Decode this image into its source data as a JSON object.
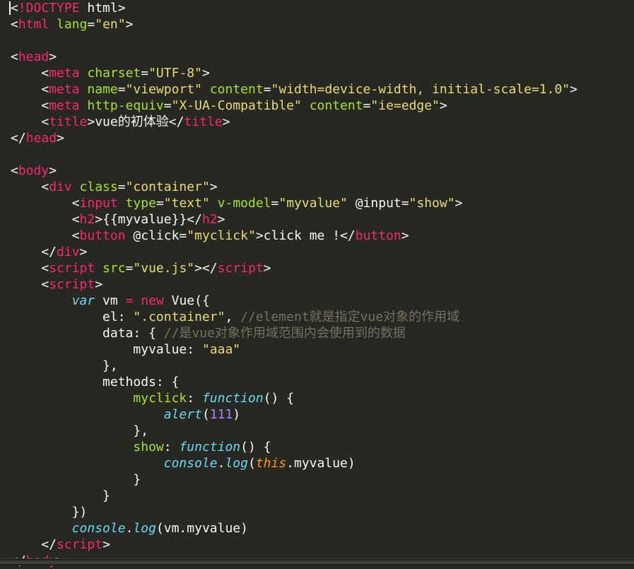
{
  "language": "html",
  "colors": {
    "background": "#272822",
    "tag": "#f92672",
    "attribute": "#a6e22e",
    "string": "#e6db74",
    "keyword": "#66d9ef",
    "comment": "#75715e",
    "number": "#ae81ff",
    "this": "#fd971f",
    "text": "#f8f8f2"
  },
  "lines": [
    [
      {
        "t": "<",
        "c": "pun"
      },
      {
        "t": "!DOCTYPE",
        "c": "dkw"
      },
      {
        "t": " html>",
        "c": "doct"
      }
    ],
    [
      {
        "t": "<",
        "c": "pun"
      },
      {
        "t": "html",
        "c": "tag"
      },
      {
        "t": " ",
        "c": "txt"
      },
      {
        "t": "lang",
        "c": "attr"
      },
      {
        "t": "=",
        "c": "pun"
      },
      {
        "t": "\"en\"",
        "c": "str"
      },
      {
        "t": ">",
        "c": "pun"
      }
    ],
    [],
    [
      {
        "t": "<",
        "c": "pun"
      },
      {
        "t": "head",
        "c": "tag"
      },
      {
        "t": ">",
        "c": "pun"
      }
    ],
    [
      {
        "t": "    <",
        "c": "pun"
      },
      {
        "t": "meta",
        "c": "tag"
      },
      {
        "t": " ",
        "c": "txt"
      },
      {
        "t": "charset",
        "c": "attr"
      },
      {
        "t": "=",
        "c": "pun"
      },
      {
        "t": "\"UTF-8\"",
        "c": "str"
      },
      {
        "t": ">",
        "c": "pun"
      }
    ],
    [
      {
        "t": "    <",
        "c": "pun"
      },
      {
        "t": "meta",
        "c": "tag"
      },
      {
        "t": " ",
        "c": "txt"
      },
      {
        "t": "name",
        "c": "attr"
      },
      {
        "t": "=",
        "c": "pun"
      },
      {
        "t": "\"viewport\"",
        "c": "str"
      },
      {
        "t": " ",
        "c": "txt"
      },
      {
        "t": "content",
        "c": "attr"
      },
      {
        "t": "=",
        "c": "pun"
      },
      {
        "t": "\"width=device-width, initial-scale=1.0\"",
        "c": "str"
      },
      {
        "t": ">",
        "c": "pun"
      }
    ],
    [
      {
        "t": "    <",
        "c": "pun"
      },
      {
        "t": "meta",
        "c": "tag"
      },
      {
        "t": " ",
        "c": "txt"
      },
      {
        "t": "http-equiv",
        "c": "attr"
      },
      {
        "t": "=",
        "c": "pun"
      },
      {
        "t": "\"X-UA-Compatible\"",
        "c": "str"
      },
      {
        "t": " ",
        "c": "txt"
      },
      {
        "t": "content",
        "c": "attr"
      },
      {
        "t": "=",
        "c": "pun"
      },
      {
        "t": "\"ie=edge\"",
        "c": "str"
      },
      {
        "t": ">",
        "c": "pun"
      }
    ],
    [
      {
        "t": "    <",
        "c": "pun"
      },
      {
        "t": "title",
        "c": "tag"
      },
      {
        "t": ">",
        "c": "pun"
      },
      {
        "t": "vue的初体验",
        "c": "txt"
      },
      {
        "t": "</",
        "c": "pun"
      },
      {
        "t": "title",
        "c": "tag"
      },
      {
        "t": ">",
        "c": "pun"
      }
    ],
    [
      {
        "t": "</",
        "c": "pun"
      },
      {
        "t": "head",
        "c": "tag"
      },
      {
        "t": ">",
        "c": "pun"
      }
    ],
    [],
    [
      {
        "t": "<",
        "c": "pun"
      },
      {
        "t": "body",
        "c": "tag"
      },
      {
        "t": ">",
        "c": "pun"
      }
    ],
    [
      {
        "t": "    <",
        "c": "pun"
      },
      {
        "t": "div",
        "c": "tag"
      },
      {
        "t": " ",
        "c": "txt"
      },
      {
        "t": "class",
        "c": "attr"
      },
      {
        "t": "=",
        "c": "pun"
      },
      {
        "t": "\"container\"",
        "c": "str"
      },
      {
        "t": ">",
        "c": "pun"
      }
    ],
    [
      {
        "t": "        <",
        "c": "pun"
      },
      {
        "t": "input",
        "c": "tag"
      },
      {
        "t": " ",
        "c": "txt"
      },
      {
        "t": "type",
        "c": "attr"
      },
      {
        "t": "=",
        "c": "pun"
      },
      {
        "t": "\"text\"",
        "c": "str"
      },
      {
        "t": " ",
        "c": "txt"
      },
      {
        "t": "v-model",
        "c": "attr"
      },
      {
        "t": "=",
        "c": "pun"
      },
      {
        "t": "\"myvalue\"",
        "c": "str"
      },
      {
        "t": " @input=",
        "c": "pun"
      },
      {
        "t": "\"show\"",
        "c": "str"
      },
      {
        "t": ">",
        "c": "pun"
      }
    ],
    [
      {
        "t": "        <",
        "c": "pun"
      },
      {
        "t": "h2",
        "c": "tag"
      },
      {
        "t": ">",
        "c": "pun"
      },
      {
        "t": "{{myvalue}}",
        "c": "txt"
      },
      {
        "t": "</",
        "c": "pun"
      },
      {
        "t": "h2",
        "c": "tag"
      },
      {
        "t": ">",
        "c": "pun"
      }
    ],
    [
      {
        "t": "        <",
        "c": "pun"
      },
      {
        "t": "button",
        "c": "tag"
      },
      {
        "t": " @click=",
        "c": "pun"
      },
      {
        "t": "\"myclick\"",
        "c": "str"
      },
      {
        "t": ">",
        "c": "pun"
      },
      {
        "t": "click me !",
        "c": "txt"
      },
      {
        "t": "</",
        "c": "pun"
      },
      {
        "t": "button",
        "c": "tag"
      },
      {
        "t": ">",
        "c": "pun"
      }
    ],
    [
      {
        "t": "    </",
        "c": "pun"
      },
      {
        "t": "div",
        "c": "tag"
      },
      {
        "t": ">",
        "c": "pun"
      }
    ],
    [
      {
        "t": "    <",
        "c": "pun"
      },
      {
        "t": "script",
        "c": "tag"
      },
      {
        "t": " ",
        "c": "txt"
      },
      {
        "t": "src",
        "c": "attr"
      },
      {
        "t": "=",
        "c": "pun"
      },
      {
        "t": "\"vue.js\"",
        "c": "str"
      },
      {
        "t": "></",
        "c": "pun"
      },
      {
        "t": "script",
        "c": "tag"
      },
      {
        "t": ">",
        "c": "pun"
      }
    ],
    [
      {
        "t": "    <",
        "c": "pun"
      },
      {
        "t": "script",
        "c": "tag"
      },
      {
        "t": ">",
        "c": "pun"
      }
    ],
    [
      {
        "t": "        ",
        "c": "txt"
      },
      {
        "t": "var",
        "c": "kw"
      },
      {
        "t": " vm ",
        "c": "txt"
      },
      {
        "t": "=",
        "c": "nw"
      },
      {
        "t": " ",
        "c": "txt"
      },
      {
        "t": "new",
        "c": "nw"
      },
      {
        "t": " Vue({",
        "c": "txt"
      }
    ],
    [
      {
        "t": "            el: ",
        "c": "txt"
      },
      {
        "t": "\".container\"",
        "c": "str"
      },
      {
        "t": ", ",
        "c": "txt"
      },
      {
        "t": "//element就是指定vue对象的作用域",
        "c": "cm"
      }
    ],
    [
      {
        "t": "            data: { ",
        "c": "txt"
      },
      {
        "t": "//是vue对象作用域范围内会使用到的数据",
        "c": "cm"
      }
    ],
    [
      {
        "t": "                myvalue: ",
        "c": "txt"
      },
      {
        "t": "\"aaa\"",
        "c": "str"
      }
    ],
    [
      {
        "t": "            },",
        "c": "txt"
      }
    ],
    [
      {
        "t": "            methods: {",
        "c": "txt"
      }
    ],
    [
      {
        "t": "                ",
        "c": "txt"
      },
      {
        "t": "myclick",
        "c": "fn"
      },
      {
        "t": ": ",
        "c": "txt"
      },
      {
        "t": "function",
        "c": "kw"
      },
      {
        "t": "() {",
        "c": "txt"
      }
    ],
    [
      {
        "t": "                    ",
        "c": "txt"
      },
      {
        "t": "alert",
        "c": "bi"
      },
      {
        "t": "(",
        "c": "txt"
      },
      {
        "t": "111",
        "c": "num"
      },
      {
        "t": ")",
        "c": "txt"
      }
    ],
    [
      {
        "t": "                },",
        "c": "txt"
      }
    ],
    [
      {
        "t": "                ",
        "c": "txt"
      },
      {
        "t": "show",
        "c": "fn"
      },
      {
        "t": ": ",
        "c": "txt"
      },
      {
        "t": "function",
        "c": "kw"
      },
      {
        "t": "() {",
        "c": "txt"
      }
    ],
    [
      {
        "t": "                    ",
        "c": "txt"
      },
      {
        "t": "console",
        "c": "bi"
      },
      {
        "t": ".",
        "c": "txt"
      },
      {
        "t": "log",
        "c": "bi"
      },
      {
        "t": "(",
        "c": "txt"
      },
      {
        "t": "this",
        "c": "ths"
      },
      {
        "t": ".myvalue)",
        "c": "txt"
      }
    ],
    [
      {
        "t": "                }",
        "c": "txt"
      }
    ],
    [
      {
        "t": "            }",
        "c": "txt"
      }
    ],
    [
      {
        "t": "        })",
        "c": "txt"
      }
    ],
    [
      {
        "t": "        ",
        "c": "txt"
      },
      {
        "t": "console",
        "c": "bi"
      },
      {
        "t": ".",
        "c": "txt"
      },
      {
        "t": "log",
        "c": "bi"
      },
      {
        "t": "(vm.myvalue)",
        "c": "txt"
      }
    ],
    [
      {
        "t": "    </",
        "c": "pun"
      },
      {
        "t": "script",
        "c": "tag"
      },
      {
        "t": ">",
        "c": "pun"
      }
    ],
    [
      {
        "t": "</",
        "c": "pun"
      },
      {
        "t": "body",
        "c": "tag"
      },
      {
        "t": ">",
        "c": "pun"
      }
    ]
  ]
}
